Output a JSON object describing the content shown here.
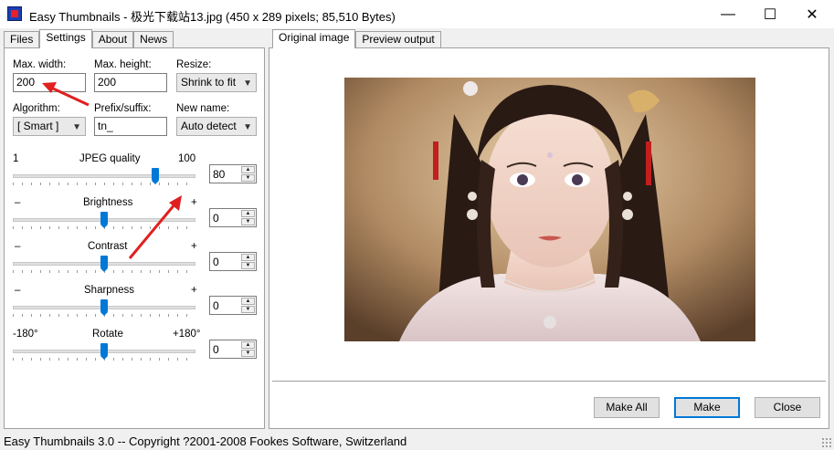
{
  "window": {
    "title": "Easy Thumbnails - 极光下载站13.jpg  (450 x 289 pixels;  85,510 Bytes)",
    "minimize": "—",
    "maximize": "☐",
    "close": "✕"
  },
  "left_tabs": [
    "Files",
    "Settings",
    "About",
    "News"
  ],
  "right_tabs": [
    "Original image",
    "Preview output"
  ],
  "settings": {
    "max_width_label": "Max. width:",
    "max_width_value": "200",
    "max_height_label": "Max. height:",
    "max_height_value": "200",
    "resize_label": "Resize:",
    "resize_value": "Shrink to fit",
    "algorithm_label": "Algorithm:",
    "algorithm_value": "[ Smart ]",
    "prefix_label": "Prefix/suffix:",
    "prefix_value": "tn_",
    "newname_label": "New name:",
    "newname_value": "Auto detect",
    "jpeg": {
      "label": "JPEG quality",
      "min_label": "1",
      "max_label": "100",
      "value": "80",
      "level": 0.79
    },
    "brightness": {
      "label": "Brightness",
      "min_label": "–",
      "max_label": "+",
      "value": "0",
      "level": 0.5
    },
    "contrast": {
      "label": "Contrast",
      "min_label": "–",
      "max_label": "+",
      "value": "0",
      "level": 0.5
    },
    "sharpness": {
      "label": "Sharpness",
      "min_label": "–",
      "max_label": "+",
      "value": "0",
      "level": 0.5
    },
    "rotate": {
      "label": "Rotate",
      "min_label": "-180°",
      "max_label": "+180°",
      "value": "0",
      "level": 0.5
    }
  },
  "buttons": {
    "make_all": "Make All",
    "make": "Make",
    "close": "Close"
  },
  "status": "Easy Thumbnails 3.0 -- Copyright ?2001-2008 Fookes Software, Switzerland",
  "colors": {
    "accent": "#0078d7",
    "annotation_arrow": "#e02020"
  }
}
